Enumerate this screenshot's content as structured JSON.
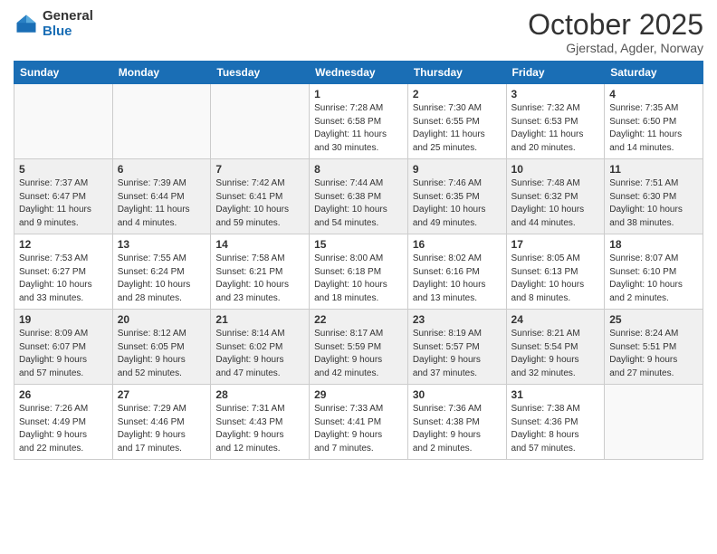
{
  "header": {
    "logo_general": "General",
    "logo_blue": "Blue",
    "month_title": "October 2025",
    "location": "Gjerstad, Agder, Norway"
  },
  "weekdays": [
    "Sunday",
    "Monday",
    "Tuesday",
    "Wednesday",
    "Thursday",
    "Friday",
    "Saturday"
  ],
  "weeks": [
    [
      {
        "day": "",
        "info": ""
      },
      {
        "day": "",
        "info": ""
      },
      {
        "day": "",
        "info": ""
      },
      {
        "day": "1",
        "info": "Sunrise: 7:28 AM\nSunset: 6:58 PM\nDaylight: 11 hours\nand 30 minutes."
      },
      {
        "day": "2",
        "info": "Sunrise: 7:30 AM\nSunset: 6:55 PM\nDaylight: 11 hours\nand 25 minutes."
      },
      {
        "day": "3",
        "info": "Sunrise: 7:32 AM\nSunset: 6:53 PM\nDaylight: 11 hours\nand 20 minutes."
      },
      {
        "day": "4",
        "info": "Sunrise: 7:35 AM\nSunset: 6:50 PM\nDaylight: 11 hours\nand 14 minutes."
      }
    ],
    [
      {
        "day": "5",
        "info": "Sunrise: 7:37 AM\nSunset: 6:47 PM\nDaylight: 11 hours\nand 9 minutes."
      },
      {
        "day": "6",
        "info": "Sunrise: 7:39 AM\nSunset: 6:44 PM\nDaylight: 11 hours\nand 4 minutes."
      },
      {
        "day": "7",
        "info": "Sunrise: 7:42 AM\nSunset: 6:41 PM\nDaylight: 10 hours\nand 59 minutes."
      },
      {
        "day": "8",
        "info": "Sunrise: 7:44 AM\nSunset: 6:38 PM\nDaylight: 10 hours\nand 54 minutes."
      },
      {
        "day": "9",
        "info": "Sunrise: 7:46 AM\nSunset: 6:35 PM\nDaylight: 10 hours\nand 49 minutes."
      },
      {
        "day": "10",
        "info": "Sunrise: 7:48 AM\nSunset: 6:32 PM\nDaylight: 10 hours\nand 44 minutes."
      },
      {
        "day": "11",
        "info": "Sunrise: 7:51 AM\nSunset: 6:30 PM\nDaylight: 10 hours\nand 38 minutes."
      }
    ],
    [
      {
        "day": "12",
        "info": "Sunrise: 7:53 AM\nSunset: 6:27 PM\nDaylight: 10 hours\nand 33 minutes."
      },
      {
        "day": "13",
        "info": "Sunrise: 7:55 AM\nSunset: 6:24 PM\nDaylight: 10 hours\nand 28 minutes."
      },
      {
        "day": "14",
        "info": "Sunrise: 7:58 AM\nSunset: 6:21 PM\nDaylight: 10 hours\nand 23 minutes."
      },
      {
        "day": "15",
        "info": "Sunrise: 8:00 AM\nSunset: 6:18 PM\nDaylight: 10 hours\nand 18 minutes."
      },
      {
        "day": "16",
        "info": "Sunrise: 8:02 AM\nSunset: 6:16 PM\nDaylight: 10 hours\nand 13 minutes."
      },
      {
        "day": "17",
        "info": "Sunrise: 8:05 AM\nSunset: 6:13 PM\nDaylight: 10 hours\nand 8 minutes."
      },
      {
        "day": "18",
        "info": "Sunrise: 8:07 AM\nSunset: 6:10 PM\nDaylight: 10 hours\nand 2 minutes."
      }
    ],
    [
      {
        "day": "19",
        "info": "Sunrise: 8:09 AM\nSunset: 6:07 PM\nDaylight: 9 hours\nand 57 minutes."
      },
      {
        "day": "20",
        "info": "Sunrise: 8:12 AM\nSunset: 6:05 PM\nDaylight: 9 hours\nand 52 minutes."
      },
      {
        "day": "21",
        "info": "Sunrise: 8:14 AM\nSunset: 6:02 PM\nDaylight: 9 hours\nand 47 minutes."
      },
      {
        "day": "22",
        "info": "Sunrise: 8:17 AM\nSunset: 5:59 PM\nDaylight: 9 hours\nand 42 minutes."
      },
      {
        "day": "23",
        "info": "Sunrise: 8:19 AM\nSunset: 5:57 PM\nDaylight: 9 hours\nand 37 minutes."
      },
      {
        "day": "24",
        "info": "Sunrise: 8:21 AM\nSunset: 5:54 PM\nDaylight: 9 hours\nand 32 minutes."
      },
      {
        "day": "25",
        "info": "Sunrise: 8:24 AM\nSunset: 5:51 PM\nDaylight: 9 hours\nand 27 minutes."
      }
    ],
    [
      {
        "day": "26",
        "info": "Sunrise: 7:26 AM\nSunset: 4:49 PM\nDaylight: 9 hours\nand 22 minutes."
      },
      {
        "day": "27",
        "info": "Sunrise: 7:29 AM\nSunset: 4:46 PM\nDaylight: 9 hours\nand 17 minutes."
      },
      {
        "day": "28",
        "info": "Sunrise: 7:31 AM\nSunset: 4:43 PM\nDaylight: 9 hours\nand 12 minutes."
      },
      {
        "day": "29",
        "info": "Sunrise: 7:33 AM\nSunset: 4:41 PM\nDaylight: 9 hours\nand 7 minutes."
      },
      {
        "day": "30",
        "info": "Sunrise: 7:36 AM\nSunset: 4:38 PM\nDaylight: 9 hours\nand 2 minutes."
      },
      {
        "day": "31",
        "info": "Sunrise: 7:38 AM\nSunset: 4:36 PM\nDaylight: 8 hours\nand 57 minutes."
      },
      {
        "day": "",
        "info": ""
      }
    ]
  ]
}
